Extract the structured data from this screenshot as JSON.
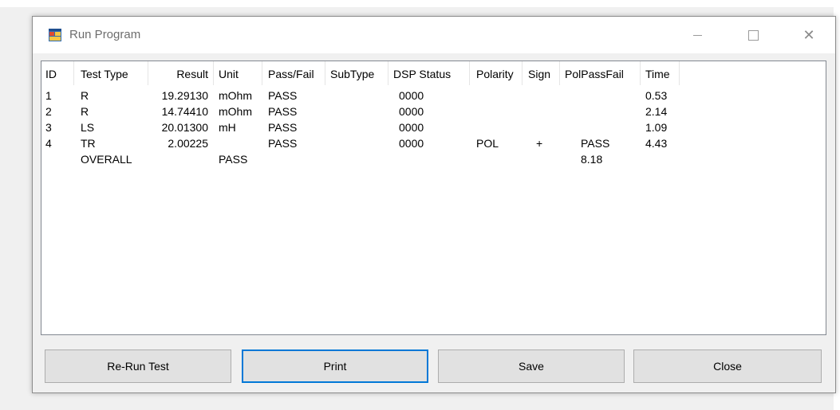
{
  "window": {
    "title": "Run Program"
  },
  "table": {
    "columns": [
      "ID",
      "Test Type",
      "Result",
      "Unit",
      "Pass/Fail",
      "SubType",
      "DSP Status",
      "Polarity",
      "Sign",
      "PolPassFail",
      "Time"
    ],
    "rows": [
      {
        "id": "1",
        "test_type": "R",
        "result": "19.29130",
        "unit": "mOhm",
        "pass_fail": "PASS",
        "subtype": "",
        "dsp_status": "0000",
        "polarity": "",
        "sign": "",
        "pol_pass_fail": "",
        "time": "0.53"
      },
      {
        "id": "2",
        "test_type": "R",
        "result": "14.74410",
        "unit": "mOhm",
        "pass_fail": "PASS",
        "subtype": "",
        "dsp_status": "0000",
        "polarity": "",
        "sign": "",
        "pol_pass_fail": "",
        "time": "2.14"
      },
      {
        "id": "3",
        "test_type": "LS",
        "result": "20.01300",
        "unit": "mH",
        "pass_fail": "PASS",
        "subtype": "",
        "dsp_status": "0000",
        "polarity": "",
        "sign": "",
        "pol_pass_fail": "",
        "time": "1.09"
      },
      {
        "id": "4",
        "test_type": "TR",
        "result": "2.00225",
        "unit": "",
        "pass_fail": "PASS",
        "subtype": "",
        "dsp_status": "0000",
        "polarity": "POL",
        "sign": "+",
        "pol_pass_fail": "PASS",
        "time": "4.43"
      }
    ],
    "overall": {
      "label": "OVERALL",
      "status": "PASS",
      "total_time": "8.18"
    }
  },
  "buttons": {
    "rerun": "Re-Run Test",
    "print": "Print",
    "save": "Save",
    "close": "Close"
  },
  "colors": {
    "focus_border": "#0078d7",
    "button_bg": "#e1e1e1"
  }
}
